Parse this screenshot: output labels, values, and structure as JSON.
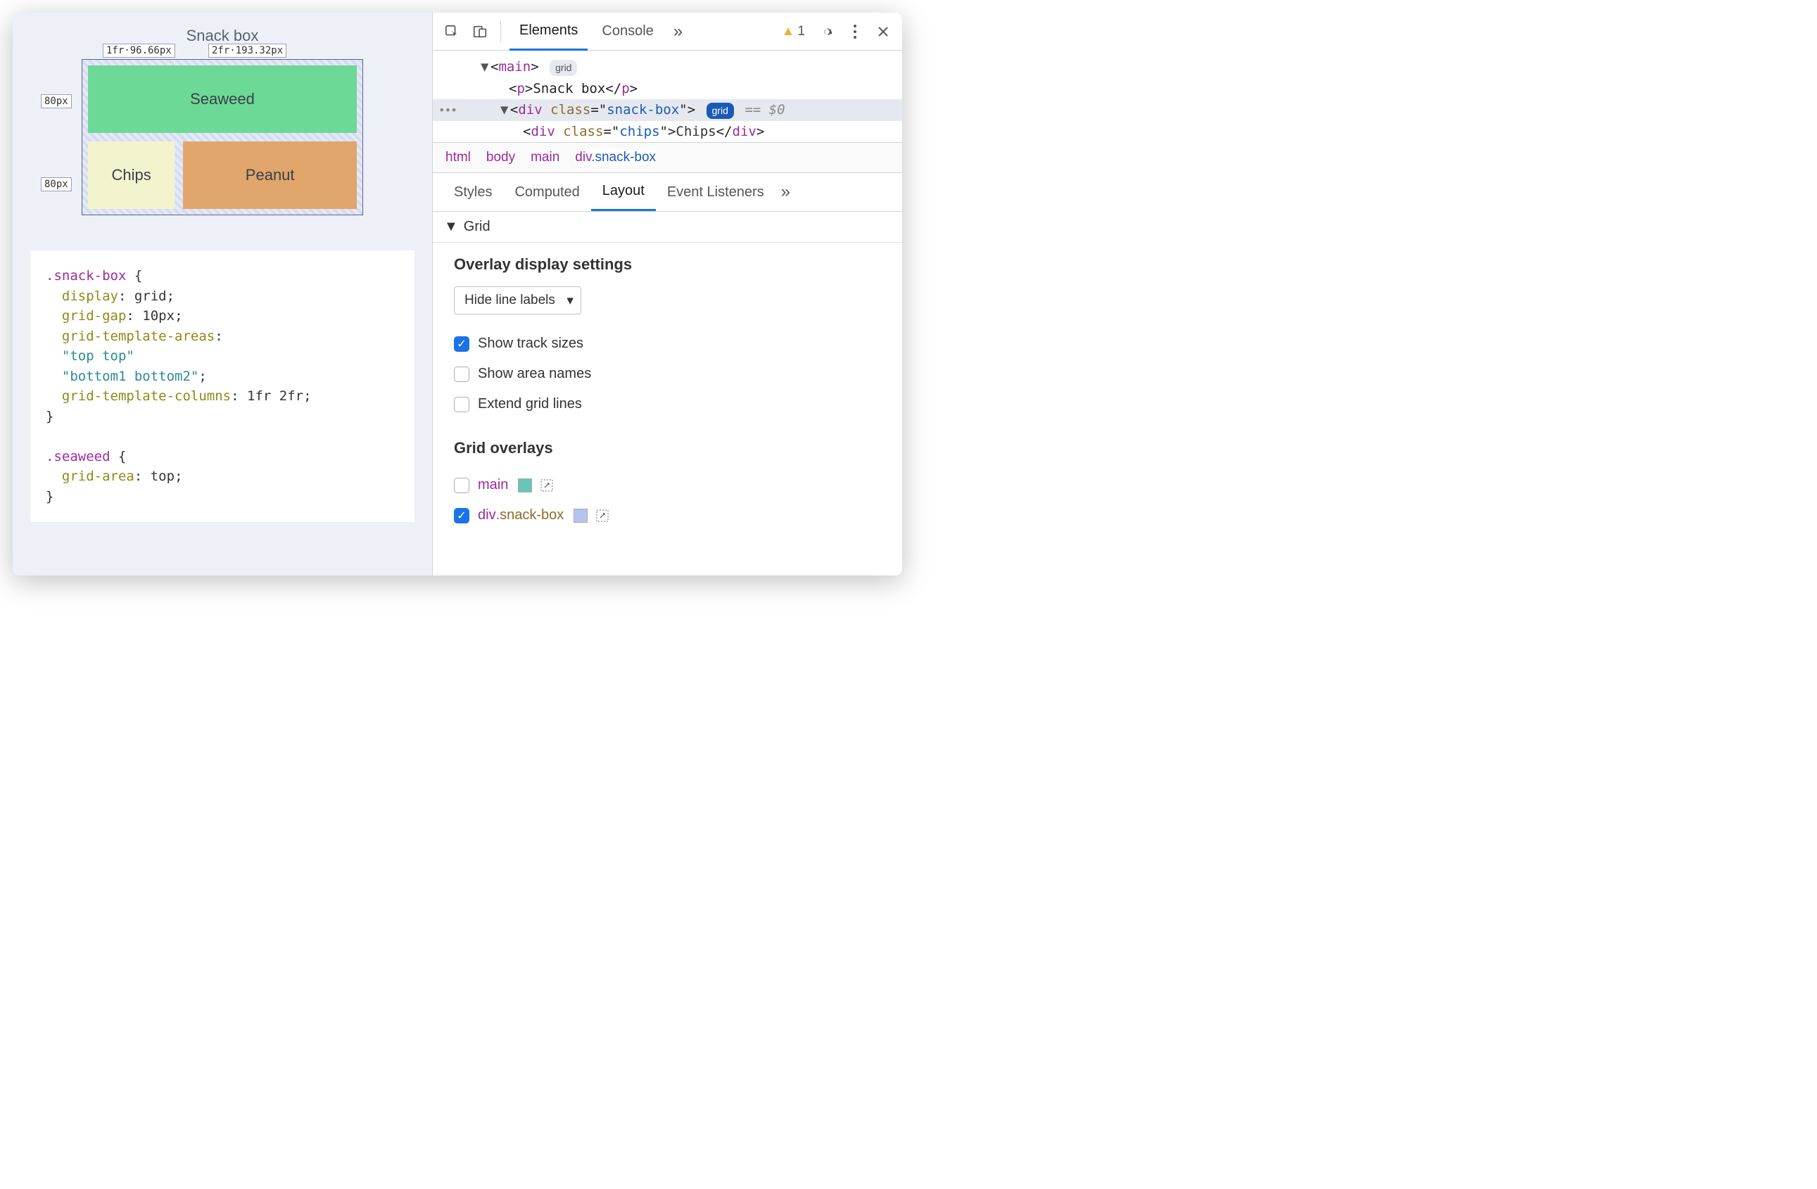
{
  "viewport": {
    "title": "Snack box",
    "track_labels": {
      "col1": "1fr·96.66px",
      "col2": "2fr·193.32px",
      "row1": "80px",
      "row2": "80px"
    },
    "cells": {
      "seaweed": "Seaweed",
      "chips": "Chips",
      "peanut": "Peanut"
    }
  },
  "css_code": ".snack-box {\n  display: grid;\n  grid-gap: 10px;\n  grid-template-areas:\n  \"top top\"\n  \"bottom1 bottom2\";\n  grid-template-columns: 1fr 2fr;\n}\n\n.seaweed {\n  grid-area: top;\n}",
  "toolbar": {
    "tabs": [
      "Elements",
      "Console"
    ],
    "active_tab": "Elements",
    "warning_count": "1"
  },
  "dom": {
    "main_open": "<main>",
    "main_badge": "grid",
    "p_line": "<p>Snack box</p>",
    "div_open_class": "snack-box",
    "div_badge": "grid",
    "eq": "== $0",
    "chips_line_class": "chips",
    "chips_line_text": "Chips"
  },
  "breadcrumb": [
    "html",
    "body",
    "main",
    "div.snack-box"
  ],
  "subtabs": [
    "Styles",
    "Computed",
    "Layout",
    "Event Listeners"
  ],
  "active_subtab": "Layout",
  "layout": {
    "section": "Grid",
    "overlay_title": "Overlay display settings",
    "select_value": "Hide line labels",
    "checks": [
      {
        "label": "Show track sizes",
        "checked": true
      },
      {
        "label": "Show area names",
        "checked": false
      },
      {
        "label": "Extend grid lines",
        "checked": false
      }
    ],
    "overlays_title": "Grid overlays",
    "overlays": [
      {
        "name": "main",
        "checked": false,
        "swatch": "#66c6b8"
      },
      {
        "name": "div.snack-box",
        "checked": true,
        "swatch": "#b7c3ef"
      }
    ]
  }
}
